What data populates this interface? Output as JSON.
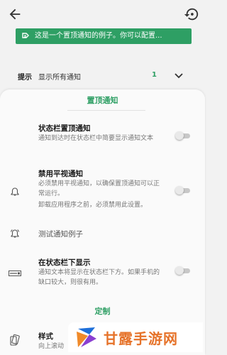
{
  "header": {
    "back_icon": "arrow-left-icon",
    "restore_icon": "restore-icon"
  },
  "banner": {
    "text": "这是一个置顶通知的例子。你可以配置...",
    "icon": "pin-notification-icon",
    "color": "#2e9f64"
  },
  "hint": {
    "label": "提示",
    "value": "显示所有通知",
    "count": "1"
  },
  "sections": {
    "pinned": "置顶通知",
    "custom": "定制"
  },
  "items": {
    "statusbar_pin": {
      "title": "状态栏置顶通知",
      "desc": "通知到达时在状态栏中简要显示通知文本"
    },
    "disable_headsup": {
      "title": "禁用平视通知",
      "desc": "必须禁用平视通知，以确保置顶通知可以正常运行。",
      "desc2": "卸载应用程序之前，必须禁用此设置。"
    },
    "test": {
      "title": "测试通知例子"
    },
    "below_statusbar": {
      "title": "在状态栏下显示",
      "desc": "通知文本将显示在状态栏下方。如果手机的缺口较大，则很有用。"
    },
    "style": {
      "title": "样式",
      "desc": "向上滚动"
    }
  },
  "watermark": {
    "text": "甘露手游网"
  },
  "colors": {
    "accent": "#2e9f64",
    "background": "#f2f2f2",
    "sheet": "#fafafa"
  }
}
